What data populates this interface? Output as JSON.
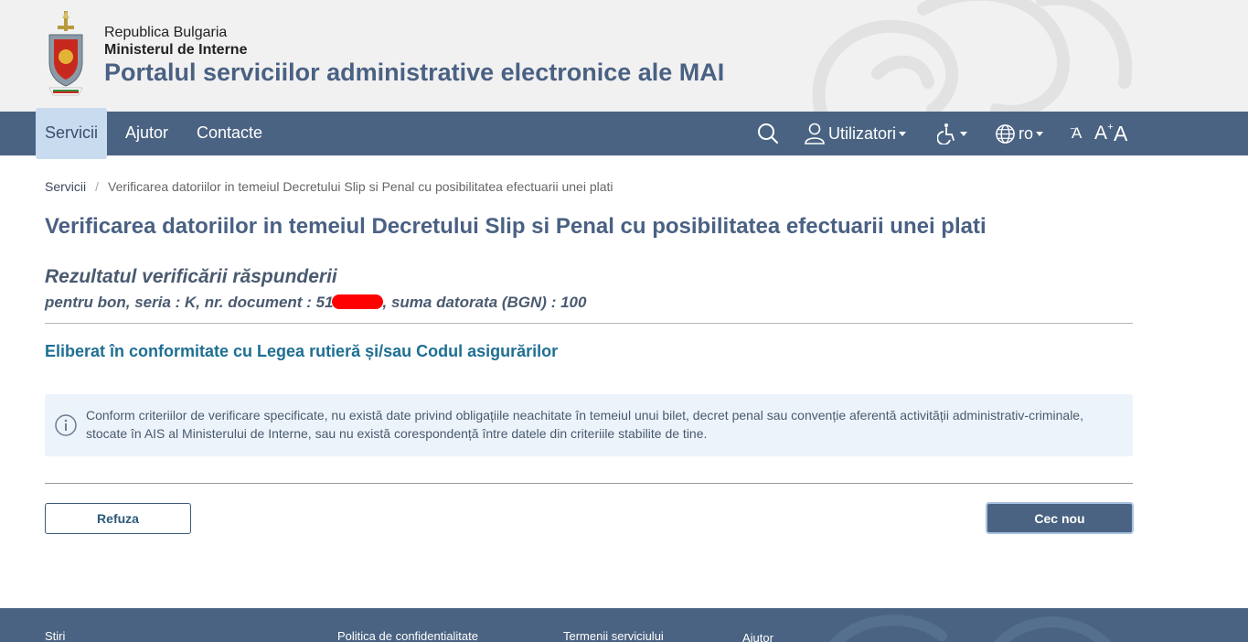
{
  "header": {
    "country": "Republica Bulgaria",
    "ministry": "Ministerul de Interne",
    "portal_title": "Portalul serviciilor administrative electronice ale MAI"
  },
  "nav": {
    "items": [
      {
        "label": "Servicii",
        "active": true
      },
      {
        "label": "Ajutor",
        "active": false
      },
      {
        "label": "Contacte",
        "active": false
      }
    ],
    "users_label": "Utilizatori",
    "language": "ro",
    "font_size_labels": [
      "A",
      "A",
      "A"
    ]
  },
  "breadcrumb": {
    "root": "Servicii",
    "separator": "/",
    "current": "Verificarea datoriilor in temeiul Decretului Slip si Penal cu posibilitatea efectuarii unei plati"
  },
  "page_title": "Verificarea datoriilor in temeiul Decretului Slip si Penal cu posibilitatea efectuarii unei plati",
  "result": {
    "title": "Rezultatul verificării răspunderii",
    "prefix": "pentru bon, seria : K, nr. document : 51",
    "suffix": ", suma datorata (BGN) : 100"
  },
  "law_heading": "Eliberat în conformitate cu Legea rutieră și/sau Codul asigurărilor",
  "info_message": "Conform criteriilor de verificare specificate, nu există date privind obligațiile neachitate în temeiul unui bilet, decret penal sau convenție aferentă activității administrativ-criminale, stocate în AIS al Ministerului de Interne, sau nu există corespondență între datele din criteriile stabilite de tine.",
  "buttons": {
    "refuse": "Refuza",
    "new_check": "Cec nou"
  },
  "footer": {
    "links": [
      "Stiri",
      "Politica de confidentialitate",
      "Termenii serviciului",
      "Ajutor"
    ]
  },
  "colors": {
    "nav_bg": "#4a6382",
    "title": "#4a6183",
    "link_heading": "#1e6f93",
    "info_bg": "#ecf3fb",
    "redaction": "#ff0000"
  }
}
